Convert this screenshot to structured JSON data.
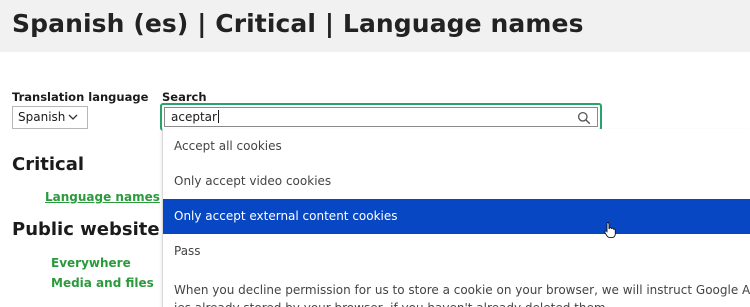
{
  "header": {
    "title": "Spanish (es) | Critical | Language names"
  },
  "translation_language": {
    "label": "Translation language",
    "value": "Spanish"
  },
  "search": {
    "label": "Search",
    "value": "aceptar",
    "options": [
      "Accept all cookies",
      "Only accept video cookies",
      "Only accept external content cookies",
      "Pass"
    ],
    "selected_index": 2,
    "long_option_line1": "When you decline permission for us to store a cookie on your browser, we will instruct Google Analytics to",
    "long_option_line2": "ies already stored by your browser, if you haven't already deleted them."
  },
  "sections": {
    "critical": {
      "heading": "Critical",
      "link": "Language names"
    },
    "public": {
      "heading": "Public website -",
      "links": [
        "Everywhere",
        "Media and files"
      ]
    }
  },
  "colors": {
    "focus_border": "#29a36a",
    "link": "#2b9a3d",
    "selected_bg": "#0747c4"
  }
}
